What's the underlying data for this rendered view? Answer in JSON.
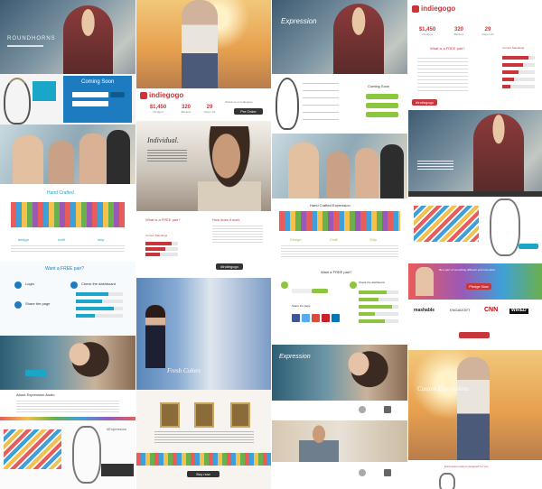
{
  "brand": {
    "indiegogo": "indiegogo",
    "expression": "Expression"
  },
  "colors": {
    "teal": "#1aa6c9",
    "indiegogo_red": "#c8363c",
    "green": "#8cc63f",
    "dark": "#333333",
    "pink": "#e8558e"
  },
  "col1": {
    "hero_word": "ROUNDHORNS",
    "coming_soon": "Coming Soon",
    "hand_crafted": "Hand Crafted",
    "features": [
      "design",
      "craft",
      "ship"
    ],
    "free_pair": "Want a FREE pair?",
    "step1": "Login",
    "step2": "Check the dashboard",
    "step3": "Share the page",
    "about": "About Expression Audio",
    "hashtag": "#Expression"
  },
  "col2": {
    "stats": [
      {
        "value": "$1,450",
        "label": "Pledged"
      },
      {
        "value": "320",
        "label": "Backers"
      },
      {
        "value": "29",
        "label": "Days Left"
      }
    ],
    "cta": "Pre Order",
    "check_indiegogo": "Check us on indiegogo",
    "individual": "Individual.",
    "free_pair": "What is a FREE pair?",
    "how_to": "How does it work",
    "current_progress": "Current Standings",
    "hashtag": "#Indiegogo",
    "artist_feature": "Fresh Colors",
    "buy_label": "Buy now"
  },
  "col3": {
    "coming_soon": "Coming Soon",
    "hand_crafted": "Hand Crafted Expression",
    "features": [
      "Design",
      "Craft",
      "Ship"
    ],
    "free_pair": "Want a FREE pair?",
    "share_label": "Share the page",
    "icons_row": [
      "f",
      "t",
      "g",
      "p",
      "in"
    ],
    "check_dash": "Check the dashboard"
  },
  "col4": {
    "stats": [
      {
        "value": "$1,450",
        "label": "Pledged"
      },
      {
        "value": "320",
        "label": "Backers"
      },
      {
        "value": "29",
        "label": "Days Left"
      }
    ],
    "free_pair": "What is a FREE pair?",
    "current_progress": "Current Standings",
    "hashtag": "#Indiegogo",
    "quote": "Be a part of something different and innovative",
    "press": [
      "mashable",
      "ENGADGET",
      "CNN",
      "WIRED"
    ],
    "cta": "Pledge Now",
    "footer_title": "Custom Expressions",
    "footer_sub": "Expression custom designed for you"
  }
}
